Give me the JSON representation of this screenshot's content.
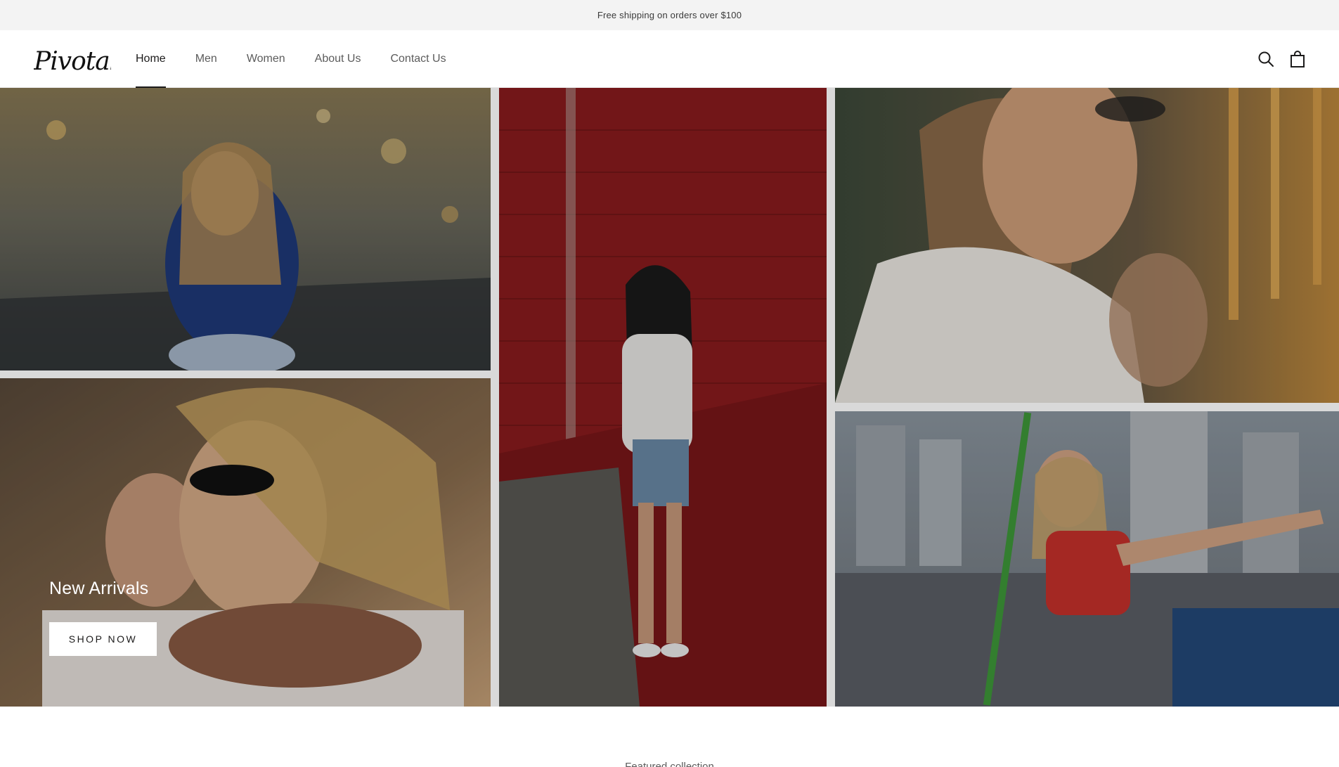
{
  "announcement": {
    "text": "Free shipping on orders over $100"
  },
  "header": {
    "logo_text": "Pivotal",
    "nav": [
      {
        "label": "Home",
        "active": true
      },
      {
        "label": "Men",
        "active": false
      },
      {
        "label": "Women",
        "active": false
      },
      {
        "label": "About Us",
        "active": false
      },
      {
        "label": "Contact Us",
        "active": false
      }
    ],
    "icons": {
      "search": "search-icon",
      "cart": "shopping-bag-icon"
    }
  },
  "hero": {
    "title": "New Arrivals",
    "button_label": "SHOP NOW",
    "images": [
      "woman-in-yellow-sunglasses-at-fairground",
      "couple-hugging-man-in-sunglasses",
      "woman-leaning-on-red-brick-wall",
      "man-with-long-hair-in-white-shirt",
      "woman-pointing-on-ride"
    ]
  },
  "featured": {
    "heading": "Featured collection"
  },
  "colors": {
    "announcement_bg": "#f3f3f3",
    "text": "#1c1b1b",
    "nav_text": "#5c5c5c",
    "button_bg": "#ffffff"
  }
}
